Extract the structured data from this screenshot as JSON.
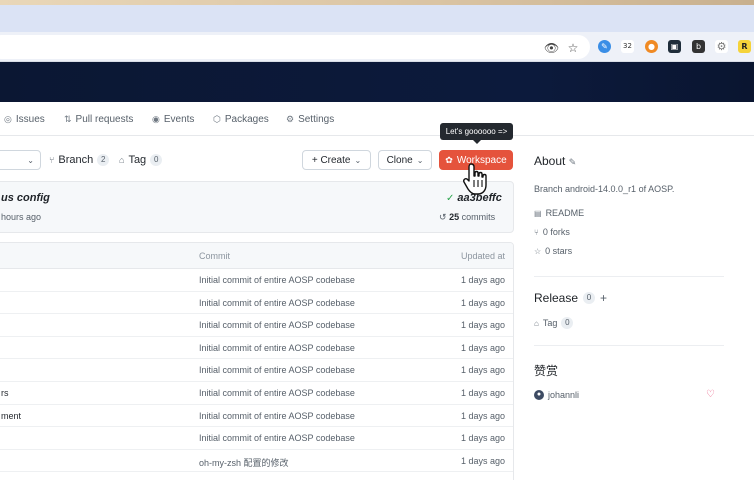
{
  "browser": {
    "extensions": [
      "eye-icon",
      "star-icon",
      "extension-blue-icon",
      "extension-counter-icon",
      "extension-orange-icon",
      "extension-dark-icon",
      "extension-book-icon",
      "extension-gear-icon",
      "extension-yellow-icon"
    ]
  },
  "repo_nav": {
    "items": [
      {
        "label": "Issues",
        "icon": "issue-icon"
      },
      {
        "label": "Pull requests",
        "icon": "pull-request-icon"
      },
      {
        "label": "Events",
        "icon": "events-icon"
      },
      {
        "label": "Packages",
        "icon": "package-icon"
      },
      {
        "label": "Settings",
        "icon": "gear-icon"
      }
    ]
  },
  "branch_bar": {
    "branch_label": "Branch",
    "branch_count": "2",
    "tag_label": "Tag",
    "tag_count": "0",
    "create_label": "+ Create",
    "clone_label": "Clone",
    "workspace_label": "Workspace",
    "tooltip": "Let's goooooo =>"
  },
  "commit": {
    "message": "us config",
    "time": "hours ago",
    "hash": "aa3beffc",
    "count": "25",
    "count_label": "commits"
  },
  "files": {
    "headers": {
      "commit": "Commit",
      "updated": "Updated at"
    },
    "rows": [
      {
        "name": "",
        "message": "Initial commit of entire AOSP codebase",
        "date": "1 days ago"
      },
      {
        "name": "",
        "message": "Initial commit of entire AOSP codebase",
        "date": "1 days ago"
      },
      {
        "name": "",
        "message": "Initial commit of entire AOSP codebase",
        "date": "1 days ago"
      },
      {
        "name": "",
        "message": "Initial commit of entire AOSP codebase",
        "date": "1 days ago"
      },
      {
        "name": "",
        "message": "Initial commit of entire AOSP codebase",
        "date": "1 days ago"
      },
      {
        "name": "rs",
        "message": "Initial commit of entire AOSP codebase",
        "date": "1 days ago"
      },
      {
        "name": "ment",
        "message": "Initial commit of entire AOSP codebase",
        "date": "1 days ago"
      },
      {
        "name": "",
        "message": "Initial commit of entire AOSP codebase",
        "date": "1 days ago"
      },
      {
        "name": "",
        "message": "oh-my-zsh 配置的修改",
        "date": "1 days ago"
      }
    ]
  },
  "about": {
    "title": "About",
    "description": "Branch android-14.0.0_r1 of AOSP.",
    "readme": "README",
    "forks": "0 forks",
    "stars": "0 stars"
  },
  "release": {
    "title": "Release",
    "count": "0",
    "tag_label": "Tag",
    "tag_count": "0"
  },
  "sponsor": {
    "title": "赞赏",
    "user": "johannli"
  },
  "colors": {
    "accent": "#e5533c",
    "banner": "#0c1a3c",
    "success": "#2da44e"
  }
}
